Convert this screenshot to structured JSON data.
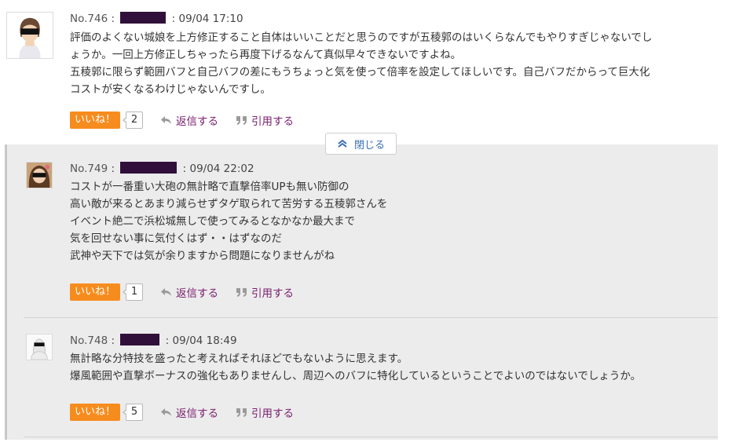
{
  "thread": {
    "close_label": "閉じる"
  },
  "comments": [
    {
      "number": "No.746",
      "separator": ":",
      "datetime": ": 09/04 17:10",
      "lines": [
        "評価のよくない城娘を上方修正すること自体はいいことだと思うのですが五稜郭のはいくらなんでもやりすぎじゃないでし",
        "ょうか。一回上方修正しちゃったら再度下げるなんて真似早々できないですよね。",
        "五稜郭に限らず範囲バフと自己バフの差にもうちょっと気を使って倍率を設定してほしいです。自己バフだからって巨大化",
        "コストが安くなるわけじゃないんですし。"
      ],
      "like_label": "いいね！",
      "like_count": "2",
      "reply_label": "返信する",
      "quote_label": "引用する"
    },
    {
      "number": "No.749",
      "separator": ":",
      "datetime": ": 09/04 22:02",
      "lines": [
        "コストが一番重い大砲の無計略で直撃倍率UPも無い防御の",
        "高い敵が来るとあまり減らせずタゲ取られて苦労する五稜郭さんを",
        "イベント絶二で浜松城無しで使ってみるとなかなか最大まで",
        "気を回せない事に気付くはず・・はずなのだ",
        "武神や天下では気が余りますから問題になりませんがね"
      ],
      "like_label": "いいね！",
      "like_count": "1",
      "reply_label": "返信する",
      "quote_label": "引用する"
    },
    {
      "number": "No.748",
      "separator": ":",
      "datetime": ": 09/04 18:49",
      "lines": [
        "無計略な分特技を盛ったと考えればそれほどでもないように思えます。",
        "爆風範囲や直撃ボーナスの強化もありませんし、周辺へのバフに特化しているということでよいのではないでしょうか。"
      ],
      "like_label": "いいね！",
      "like_count": "5",
      "reply_label": "返信する",
      "quote_label": "引用する"
    }
  ],
  "colors": {
    "like_button": "#f78c1e",
    "link": "#7a1f6e",
    "close_link": "#3a6fb3",
    "redaction": "#30103a",
    "thread_background": "#ececec"
  },
  "icons": {
    "reply": "reply-arrow-icon",
    "quote": "quote-icon",
    "close": "chevron-up-double-icon"
  }
}
